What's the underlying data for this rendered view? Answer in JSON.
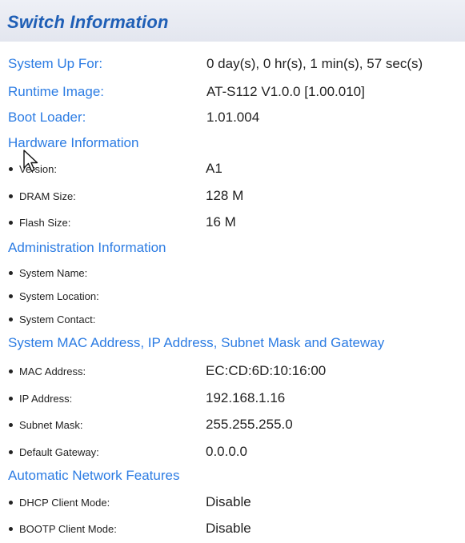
{
  "page": {
    "title": "Switch Information"
  },
  "summary": {
    "items": [
      {
        "label": "System Up For:",
        "value": "0 day(s), 0 hr(s), 1 min(s), 57 sec(s)"
      },
      {
        "label": "Runtime Image:",
        "value": "AT-S112 V1.0.0 [1.00.010]"
      },
      {
        "label": "Boot Loader:",
        "value": "1.01.004"
      }
    ]
  },
  "sections": [
    {
      "title": "Hardware Information",
      "items": [
        {
          "label": "Version:",
          "value": "A1"
        },
        {
          "label": "DRAM Size:",
          "value": "128 M"
        },
        {
          "label": "Flash Size:",
          "value": "16 M"
        }
      ]
    },
    {
      "title": "Administration Information",
      "items": [
        {
          "label": "System Name:",
          "value": ""
        },
        {
          "label": "System Location:",
          "value": ""
        },
        {
          "label": "System Contact:",
          "value": ""
        }
      ]
    },
    {
      "title": "System MAC Address, IP Address, Subnet Mask and Gateway",
      "items": [
        {
          "label": "MAC Address:",
          "value": "EC:CD:6D:10:16:00"
        },
        {
          "label": "IP Address:",
          "value": "192.168.1.16"
        },
        {
          "label": "Subnet Mask:",
          "value": "255.255.255.0"
        },
        {
          "label": "Default Gateway:",
          "value": "0.0.0.0"
        }
      ]
    },
    {
      "title": "Automatic Network Features",
      "items": [
        {
          "label": "DHCP Client Mode:",
          "value": "Disable"
        },
        {
          "label": "BOOTP Client Mode:",
          "value": "Disable"
        }
      ]
    }
  ],
  "icons": {
    "cursor": "mouse-pointer-icon"
  },
  "colors": {
    "title": "#1f5fb6",
    "label_blue": "#2c7ce3",
    "text": "#222222",
    "header_bg": "#e8ebf3"
  }
}
